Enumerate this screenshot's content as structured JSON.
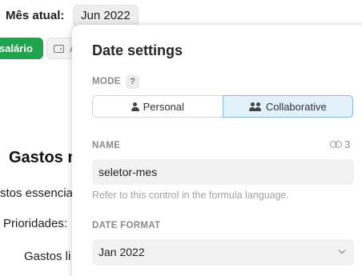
{
  "background": {
    "month_label": "Mês atual:",
    "month_value": "Jun 2022",
    "green_button_label": "salário",
    "grey_button_char": "A",
    "section_title": "Gastos m",
    "row1": "stos essencia",
    "row2": "Prioridades:",
    "row3": "Gastos li"
  },
  "panel": {
    "title": "Date settings",
    "mode": {
      "label": "MODE",
      "help": "?",
      "options": [
        {
          "label": "Personal",
          "icon": "person-icon",
          "selected": false
        },
        {
          "label": "Collaborative",
          "icon": "people-icon",
          "selected": true
        }
      ]
    },
    "name": {
      "label": "NAME",
      "ref_count": "3",
      "value": "seletor-mes",
      "hint": "Refer to this control in the formula language."
    },
    "date_format": {
      "label": "DATE FORMAT",
      "value": "Jan 2022"
    }
  },
  "colors": {
    "accent_green": "#1ea44c",
    "selected_bg": "#e3f1fb",
    "selected_border": "#7fb8e0"
  }
}
